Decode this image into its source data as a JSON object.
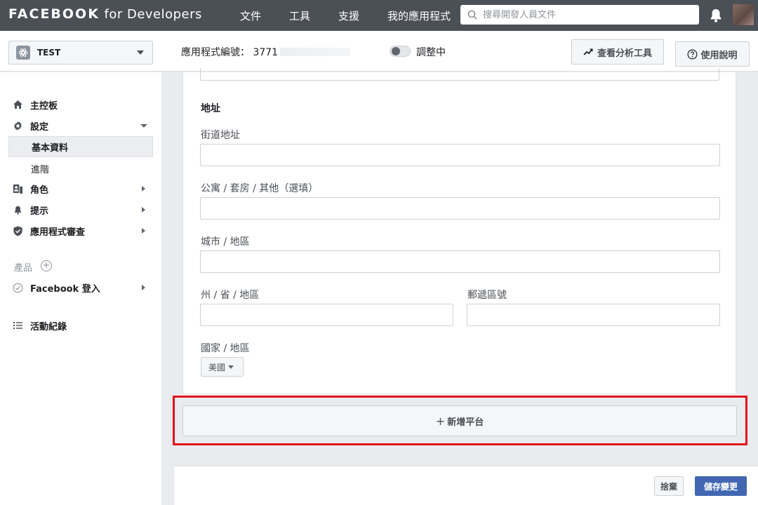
{
  "topnav": {
    "brand_main": "FACEBOOK",
    "brand_sub": "for Developers",
    "links": [
      "文件",
      "工具",
      "支援",
      "我的應用程式"
    ],
    "search_placeholder": "搜尋開發人員文件"
  },
  "subheader": {
    "app_name": "TEST",
    "app_id_label": "應用程式編號：",
    "app_id_visible": "3771",
    "mode_label": "調整中",
    "analytics_button": "查看分析工具",
    "help_button": "使用說明"
  },
  "sidebar": {
    "dashboard": "主控板",
    "settings": "設定",
    "settings_basic": "基本資料",
    "settings_advanced": "進階",
    "roles": "角色",
    "alerts": "提示",
    "app_review": "應用程式審查",
    "products_label": "產品",
    "facebook_login": "Facebook 登入",
    "activity_log": "活動紀錄"
  },
  "form": {
    "section_title": "地址",
    "street_label": "街道地址",
    "street_value": "",
    "apt_label": "公寓 / 套房 / 其他（選填）",
    "apt_value": "",
    "city_label": "城市 / 地區",
    "city_value": "",
    "state_label": "州 / 省 / 地區",
    "state_value": "",
    "zip_label": "郵遞區號",
    "zip_value": "",
    "country_label": "國家 / 地區",
    "country_value": "美國"
  },
  "add_platform_label": "新增平台",
  "footer": {
    "discard": "捨棄",
    "save": "儲存變更"
  },
  "colors": {
    "nav_bg": "#4b4f56",
    "primary": "#4267b2",
    "highlight": "#e4141b"
  }
}
